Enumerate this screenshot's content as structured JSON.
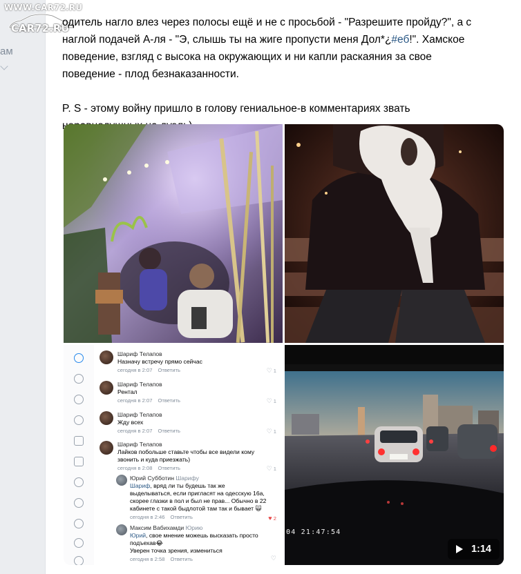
{
  "watermark": {
    "top_text": "WWW.CAR72.RU",
    "main_text": "CAR72.RU"
  },
  "sidebar": {
    "label": "ам"
  },
  "post": {
    "line1": "одитель нагло влез через полосы ещё и не с просьбой - \"Разрешите пройду?\", а с",
    "line2_pre": "наглой подачей А-ля - \"Э, слышь ты на жиге пропусти меня Дол*¿",
    "hashtag": "#еб",
    "line2_post": "!\". Хамское",
    "line3": "поведение, взгляд с высока на окружающих и ни капли раскаяния за свое",
    "line4": "поведение - плод безнаказанности.",
    "line5": "P. S - этому войну пришло в голову гениальное-в комментариях звать",
    "line6": "неравнодушных на дуэль)"
  },
  "comments": [
    {
      "author": "Шариф Телапов",
      "text": "Назначу встречу прямо сейчас",
      "time": "сегодня в 2:07",
      "reply": "Ответить",
      "likes": "1"
    },
    {
      "author": "Шариф Телапов",
      "text": "Рентал",
      "time": "сегодня в 2:07",
      "reply": "Ответить",
      "likes": "1"
    },
    {
      "author": "Шариф Телапов",
      "text": "Жду всех",
      "time": "сегодня в 2:07",
      "reply": "Ответить",
      "likes": "1"
    },
    {
      "author": "Шариф Телапов",
      "text": "Лайков побольше ставьте чтобы все видели кому звонить и куда приезжать)",
      "time": "сегодня в 2:08",
      "reply": "Ответить",
      "likes": "1"
    },
    {
      "author": "Юрий Субботин",
      "to": "Шарифу",
      "mention": "Шариф",
      "text": ", вряд ли ты будешь так же выделываться, если пригласят на одесскую 16а, скорее глазки в пол и был не прав... Обычно в 22 кабинете с такой быдлотой там так и бывает 🙀",
      "time": "сегодня в 2:46",
      "reply": "Ответить",
      "likes": "2"
    },
    {
      "author": "Максим Вабихамди",
      "to": "Юрию",
      "mention": "Юрий",
      "text": ", свое мнение можешь высказать просто подъехав😂",
      "text2": "Уверен точка зрения, измениться",
      "time": "сегодня в 2:58",
      "reply": "Ответить",
      "likes": ""
    }
  ],
  "video": {
    "timestamp": "04 21:47:54",
    "duration": "1:14"
  },
  "colors": {
    "link": "#2a5885",
    "meta": "#818c99",
    "like_active": "#e64646",
    "nav_active": "#2688eb"
  }
}
